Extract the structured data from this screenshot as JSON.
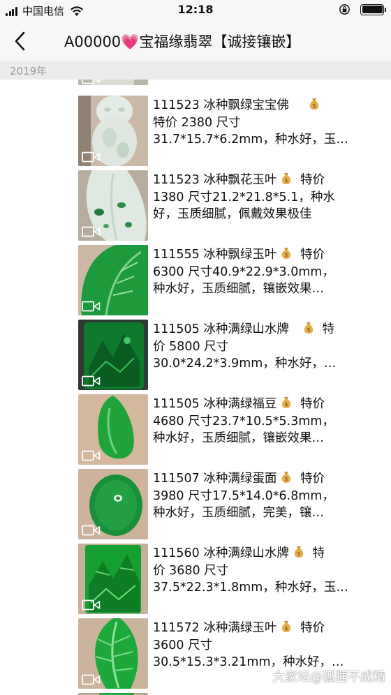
{
  "status_bar": {
    "carrier": "中国电信",
    "time": "12:18"
  },
  "nav": {
    "title": "A00000💗宝福缘翡翠【诚接镶嵌】"
  },
  "section": {
    "year": "2019年"
  },
  "items": [
    {
      "lines": [
        "111523  冰种飘绿宝宝佛",
        "特价 2380  尺寸",
        "31.7*15.7*6.2mm，种水好，玉…"
      ]
    },
    {
      "lines": [
        "111523  冰种飘花玉叶",
        "1380  尺寸21.2*21.8*5.1，种水",
        "好，玉质细腻，佩戴效果极佳"
      ]
    },
    {
      "lines": [
        "111555  冰种飘绿玉叶",
        " 6300  尺寸40.9*22.9*3.0mm，",
        "种水好，玉质细腻，镶嵌效果…"
      ]
    },
    {
      "lines": [
        "111505  冰种满绿山水牌",
        "价  5800  尺寸",
        "30.0*24.2*3.9mm，种水好，…"
      ]
    },
    {
      "lines": [
        "111505  冰种满绿福豆",
        " 4680  尺寸23.7*10.5*5.3mm，",
        "种水好，玉质细腻，镶嵌效果…"
      ]
    },
    {
      "lines": [
        "111507  冰种满绿蛋面",
        " 3980  尺寸17.5*14.0*6.8mm，",
        "种水好，玉质细腻，完美，镶…"
      ]
    },
    {
      "lines": [
        "111560   冰种满绿山水牌",
        "价  3680  尺寸",
        "37.5*22.3*1.8mm，种水好，玉…"
      ]
    },
    {
      "lines": [
        "111572  冰种满绿玉叶",
        " 3600  尺寸",
        "30.5*15.3*3.21mm，种水好，…"
      ]
    }
  ],
  "money_suffix": [
    "",
    "特价",
    "特价",
    "特",
    "特价",
    "特价",
    "特",
    "特价"
  ],
  "watermark": "大家坛@狐狸不成精",
  "colors": {
    "nav_bg": "#f7f7f7",
    "year_bar_bg": "#ececec",
    "jade_green": "#1fa33a",
    "ice_jade": "#cfe3d6"
  }
}
